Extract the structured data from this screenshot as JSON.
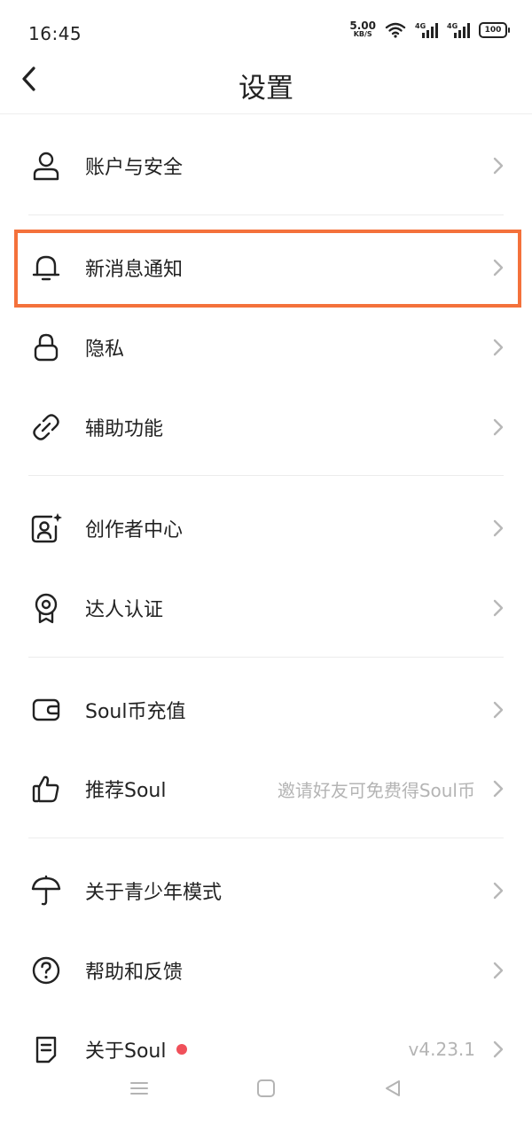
{
  "status_bar": {
    "time": "16:45",
    "net_speed_value": "5.00",
    "net_speed_unit": "KB/S",
    "network_1": "4G",
    "network_2": "4G",
    "battery": "100"
  },
  "header": {
    "title": "设置",
    "back_icon": "chevron-left-icon"
  },
  "menu": {
    "items": [
      {
        "label": "账户与安全",
        "icon": "user-icon"
      },
      {
        "label": "新消息通知",
        "icon": "bell-icon"
      },
      {
        "label": "隐私",
        "icon": "lock-icon"
      },
      {
        "label": "辅助功能",
        "icon": "link-icon"
      },
      {
        "label": "创作者中心",
        "icon": "creator-icon"
      },
      {
        "label": "达人认证",
        "icon": "badge-icon"
      },
      {
        "label": "Soul币充值",
        "icon": "wallet-icon"
      },
      {
        "label": "推荐Soul",
        "icon": "thumbs-up-icon",
        "subtext": "邀请好友可免费得Soul币"
      },
      {
        "label": "关于青少年模式",
        "icon": "umbrella-icon"
      },
      {
        "label": "帮助和反馈",
        "icon": "help-icon"
      },
      {
        "label": "关于Soul",
        "icon": "document-icon",
        "subtext": "v4.23.1",
        "badge": "red-dot"
      }
    ]
  },
  "colors": {
    "highlight": "#f4713b",
    "red_dot": "#f0505a",
    "chevron": "#b8b8b8",
    "subtext": "#b4b4b4"
  },
  "nav_bar": {
    "menu_icon": "menu-icon",
    "home_icon": "square-icon",
    "back_icon": "triangle-back-icon"
  }
}
